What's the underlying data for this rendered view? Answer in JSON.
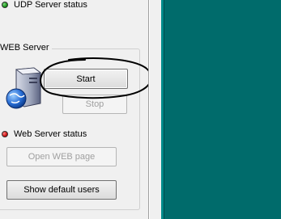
{
  "udp": {
    "status_label": "UDP Server status",
    "led_color": "#0a8a0a"
  },
  "web_server": {
    "group_title": "WEB Server",
    "start_label": "Start",
    "stop_label": "Stop",
    "status_label": "Web Server status",
    "led_color": "#c00000",
    "open_page_label": "Open WEB page",
    "default_users_label": "Show default users"
  },
  "icons": {
    "server": "server-globe-icon",
    "annotation": "hand-drawn-circle"
  },
  "colors": {
    "desktop": "#006b6b",
    "panel": "#f0f0f0",
    "annotation": "#000000"
  }
}
